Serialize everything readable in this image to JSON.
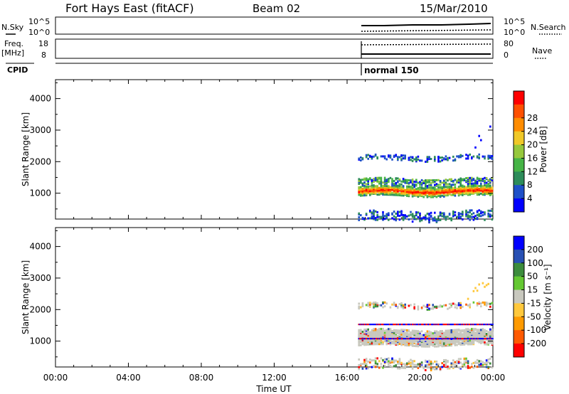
{
  "header": {
    "title": "Fort Hays East (fitACF)",
    "beam": "Beam 02",
    "date": "15/Mar/2010"
  },
  "summary_panel": {
    "nsky_label": "N.Sky",
    "nsky_ticks": [
      "10^5",
      "10^0"
    ],
    "nsearch_label": "N.Search",
    "nsearch_ticks": [
      "10^5",
      "10^0"
    ],
    "freq_label": "Freq.",
    "freq_unit": "[MHz]",
    "freq_ticks": [
      "18",
      "8"
    ],
    "nave_label": "Nave",
    "nave_ticks": [
      "80",
      "0"
    ],
    "cpid_label": "CPID",
    "cpid_value": "normal 150"
  },
  "colors": {
    "scatter_gray": "#c8c8be",
    "power_scale": [
      "#0000ff",
      "#1e50c8",
      "#2d8c5a",
      "#46b446",
      "#96c83c",
      "#f0c828",
      "#ff8c00",
      "#ff5000",
      "#ff0000"
    ],
    "velocity_scale": [
      "#ff0000",
      "#ff5a00",
      "#ff9a00",
      "#ffc83c",
      "#c8c8be",
      "#64c832",
      "#3c8c3c",
      "#2850b4",
      "#0000ff"
    ]
  },
  "chart_data": [
    {
      "type": "heatmap",
      "name": "power",
      "ylabel": "Slant Range [km]",
      "xlabel": "Time UT",
      "x_ticks": [
        "00:00",
        "04:00",
        "08:00",
        "12:00",
        "16:00",
        "20:00",
        "00:00"
      ],
      "xlim_hours": [
        0,
        24
      ],
      "y_ticks": [
        "1000",
        "2000",
        "3000",
        "4000"
      ],
      "ylim_km": [
        180,
        4600
      ],
      "colorbar_label": "Power [dB]",
      "colorbar_ticks": [
        "4",
        "8",
        "12",
        "16",
        "20",
        "24",
        "28"
      ],
      "data_start_hour": 16.6,
      "bands": [
        {
          "center_km": 1100,
          "halfwidth_km": 150,
          "level": "high"
        },
        {
          "center_km": 1400,
          "halfwidth_km": 100,
          "level": "medium"
        },
        {
          "center_km": 2150,
          "halfwidth_km": 80,
          "level": "low"
        },
        {
          "center_km": 300,
          "halfwidth_km": 150,
          "level": "low"
        }
      ]
    },
    {
      "type": "heatmap",
      "name": "velocity",
      "ylabel": "Slant Range [km]",
      "xlabel": "Time UT",
      "x_ticks": [
        "00:00",
        "04:00",
        "08:00",
        "12:00",
        "16:00",
        "20:00",
        "00:00"
      ],
      "xlim_hours": [
        0,
        24
      ],
      "y_ticks": [
        "1000",
        "2000",
        "3000",
        "4000"
      ],
      "ylim_km": [
        180,
        4600
      ],
      "colorbar_label": "Velocity [m s⁻¹]",
      "colorbar_ticks": [
        "200",
        "100",
        "50",
        "15",
        "-15",
        "-50",
        "-100",
        "-200"
      ],
      "data_start_hour": 16.6,
      "bands": [
        {
          "center_km": 1150,
          "halfwidth_km": 250,
          "level": "ground"
        },
        {
          "center_km": 2150,
          "halfwidth_km": 80,
          "level": "mixed"
        },
        {
          "center_km": 300,
          "halfwidth_km": 150,
          "level": "mixed"
        }
      ]
    }
  ]
}
